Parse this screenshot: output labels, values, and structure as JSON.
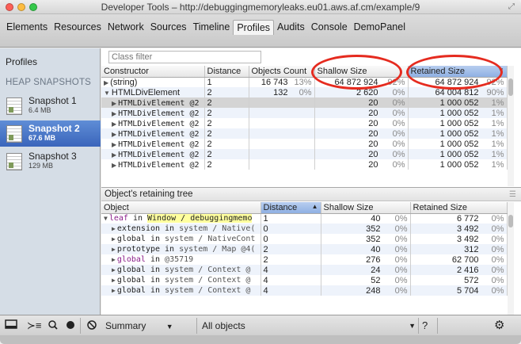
{
  "window": {
    "title": "Developer Tools – http://debuggingmemoryleaks.eu01.aws.af.cm/example/9"
  },
  "tabs": [
    {
      "label": "Elements"
    },
    {
      "label": "Resources"
    },
    {
      "label": "Network"
    },
    {
      "label": "Sources"
    },
    {
      "label": "Timeline"
    },
    {
      "label": "Profiles"
    },
    {
      "label": "Audits"
    },
    {
      "label": "Console"
    },
    {
      "label": "DemoPanel"
    }
  ],
  "active_tab": "Profiles",
  "sidebar": {
    "title": "Profiles",
    "section": "HEAP SNAPSHOTS",
    "snapshots": [
      {
        "name": "Snapshot 1",
        "size": "6.4 MB"
      },
      {
        "name": "Snapshot 2",
        "size": "67.6 MB"
      },
      {
        "name": "Snapshot 3",
        "size": "129 MB"
      }
    ],
    "selected": "Snapshot 2"
  },
  "filter": {
    "placeholder": "Class filter"
  },
  "constructors": {
    "columns": [
      "Constructor",
      "Distance",
      "Objects Count",
      "Shallow Size",
      "Retained Size"
    ],
    "sorted_column": "Retained Size",
    "rows": [
      {
        "name": "(string)",
        "distance": "1",
        "count": "16 743",
        "count_pct": "13%",
        "shallow": "64 872 924",
        "shallow_pct": "92%",
        "retained": "64 872 924",
        "retained_pct": "92%"
      },
      {
        "name": "HTMLDivElement",
        "distance": "2",
        "count": "132",
        "count_pct": "0%",
        "shallow": "2 620",
        "shallow_pct": "0%",
        "retained": "64 004 812",
        "retained_pct": "90%"
      },
      {
        "name": "HTMLDivElement @2",
        "distance": "2",
        "count": "",
        "count_pct": "",
        "shallow": "20",
        "shallow_pct": "0%",
        "retained": "1 000 052",
        "retained_pct": "1%"
      },
      {
        "name": "HTMLDivElement @2",
        "distance": "2",
        "count": "",
        "count_pct": "",
        "shallow": "20",
        "shallow_pct": "0%",
        "retained": "1 000 052",
        "retained_pct": "1%"
      },
      {
        "name": "HTMLDivElement @2",
        "distance": "2",
        "count": "",
        "count_pct": "",
        "shallow": "20",
        "shallow_pct": "0%",
        "retained": "1 000 052",
        "retained_pct": "1%"
      },
      {
        "name": "HTMLDivElement @2",
        "distance": "2",
        "count": "",
        "count_pct": "",
        "shallow": "20",
        "shallow_pct": "0%",
        "retained": "1 000 052",
        "retained_pct": "1%"
      },
      {
        "name": "HTMLDivElement @2",
        "distance": "2",
        "count": "",
        "count_pct": "",
        "shallow": "20",
        "shallow_pct": "0%",
        "retained": "1 000 052",
        "retained_pct": "1%"
      },
      {
        "name": "HTMLDivElement @2",
        "distance": "2",
        "count": "",
        "count_pct": "",
        "shallow": "20",
        "shallow_pct": "0%",
        "retained": "1 000 052",
        "retained_pct": "1%"
      },
      {
        "name": "HTMLDivElement @2",
        "distance": "2",
        "count": "",
        "count_pct": "",
        "shallow": "20",
        "shallow_pct": "0%",
        "retained": "1 000 052",
        "retained_pct": "1%"
      }
    ]
  },
  "retaining_tree": {
    "title": "Object's retaining tree",
    "columns": [
      "Object",
      "Distance",
      "Shallow Size",
      "Retained Size"
    ],
    "sorted_column": "Distance",
    "rows": [
      {
        "prop": "leaf",
        "sep": " in ",
        "holder": "Window / debuggingmemo",
        "distance": "1",
        "shallow": "40",
        "shallow_pct": "0%",
        "retained": "6 772",
        "retained_pct": "0%"
      },
      {
        "prop": "extension",
        "sep": " in ",
        "holder": "system / Native(",
        "distance": "0",
        "shallow": "352",
        "shallow_pct": "0%",
        "retained": "3 492",
        "retained_pct": "0%"
      },
      {
        "prop": "global",
        "sep": " in ",
        "holder": "system / NativeCont",
        "distance": "0",
        "shallow": "352",
        "shallow_pct": "0%",
        "retained": "3 492",
        "retained_pct": "0%"
      },
      {
        "prop": "prototype",
        "sep": " in ",
        "holder": "system / Map @4(",
        "distance": "2",
        "shallow": "40",
        "shallow_pct": "0%",
        "retained": "312",
        "retained_pct": "0%"
      },
      {
        "prop": "global",
        "sep": " in ",
        "holder": "@35719",
        "distance": "2",
        "shallow": "276",
        "shallow_pct": "0%",
        "retained": "62 700",
        "retained_pct": "0%"
      },
      {
        "prop": "global",
        "sep": " in ",
        "holder": "system / Context @",
        "distance": "4",
        "shallow": "24",
        "shallow_pct": "0%",
        "retained": "2 416",
        "retained_pct": "0%"
      },
      {
        "prop": "global",
        "sep": " in ",
        "holder": "system / Context @",
        "distance": "4",
        "shallow": "52",
        "shallow_pct": "0%",
        "retained": "572",
        "retained_pct": "0%"
      },
      {
        "prop": "global",
        "sep": " in ",
        "holder": "system / Context @",
        "distance": "4",
        "shallow": "248",
        "shallow_pct": "0%",
        "retained": "5 704",
        "retained_pct": "0%"
      }
    ]
  },
  "statusbar": {
    "view_select": "Summary",
    "filter_select": "All objects",
    "help": "?"
  },
  "colors": {
    "selected_snapshot": "#3a65bb",
    "annotation": "#e52b1f",
    "highlight": "#ffff9e",
    "sorted_header": "#8fb0e3"
  }
}
